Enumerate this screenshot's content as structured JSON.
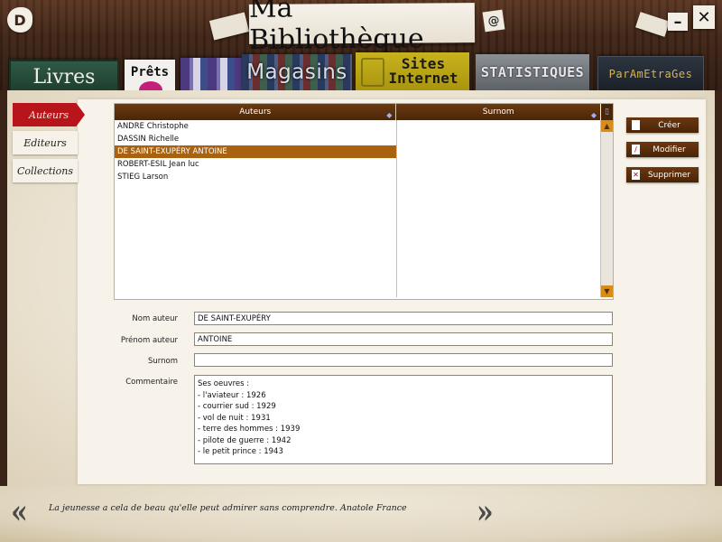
{
  "app": {
    "title": "Ma Bibliothèque",
    "icon": "d-book-icon",
    "email_icon": "@",
    "minimize": "–",
    "close": "✕"
  },
  "tabs": {
    "livres": "Livres",
    "prets": "Prêts",
    "magasins": "Magasins",
    "sites_line1": "Sites",
    "sites_line2": "Internet",
    "statistiques": "STATISTIQUES",
    "parametrages": "ParAmEtraGes"
  },
  "sidebar": {
    "items": [
      {
        "label": "Auteurs",
        "active": true
      },
      {
        "label": "Editeurs",
        "active": false
      },
      {
        "label": "Collections",
        "active": false
      }
    ]
  },
  "grid": {
    "columns": [
      "Auteurs",
      "Surnom"
    ],
    "rows": [
      {
        "auteur": "ANDRE Christophe",
        "surnom": ""
      },
      {
        "auteur": "DASSIN Richelle",
        "surnom": ""
      },
      {
        "auteur": "DE SAINT-EXUPÉRY ANTOINE",
        "surnom": "",
        "selected": true
      },
      {
        "auteur": "ROBERT-ESIL Jean luc",
        "surnom": ""
      },
      {
        "auteur": "STIEG Larson",
        "surnom": ""
      }
    ]
  },
  "actions": {
    "create": "Créer",
    "modify": "Modifier",
    "delete": "Supprimer"
  },
  "form": {
    "nom_label": "Nom auteur",
    "nom_value": "DE SAINT-EXUPÉRY",
    "prenom_label": "Prénom auteur",
    "prenom_value": "ANTOINE",
    "surnom_label": "Surnom",
    "surnom_value": "",
    "commentaire_label": "Commentaire",
    "commentaire_lines": [
      "Ses oeuvres :",
      "- l'aviateur : 1926",
      "- courrier sud : 1929",
      "- vol de nuit : 1931",
      "- terre des hommes : 1939",
      "- pilote de guerre : 1942",
      "- le petit prince : 1943"
    ]
  },
  "footer": {
    "quote": "La jeunesse a cela de beau qu'elle peut admirer sans comprendre.  Anatole France",
    "prev": "«",
    "next": "»"
  },
  "colors": {
    "wood": "#3f2416",
    "header_brown": "#5a2f0c",
    "selected_row": "#a9620f",
    "active_side_tab": "#b8141b",
    "paper": "#f4efe4"
  }
}
